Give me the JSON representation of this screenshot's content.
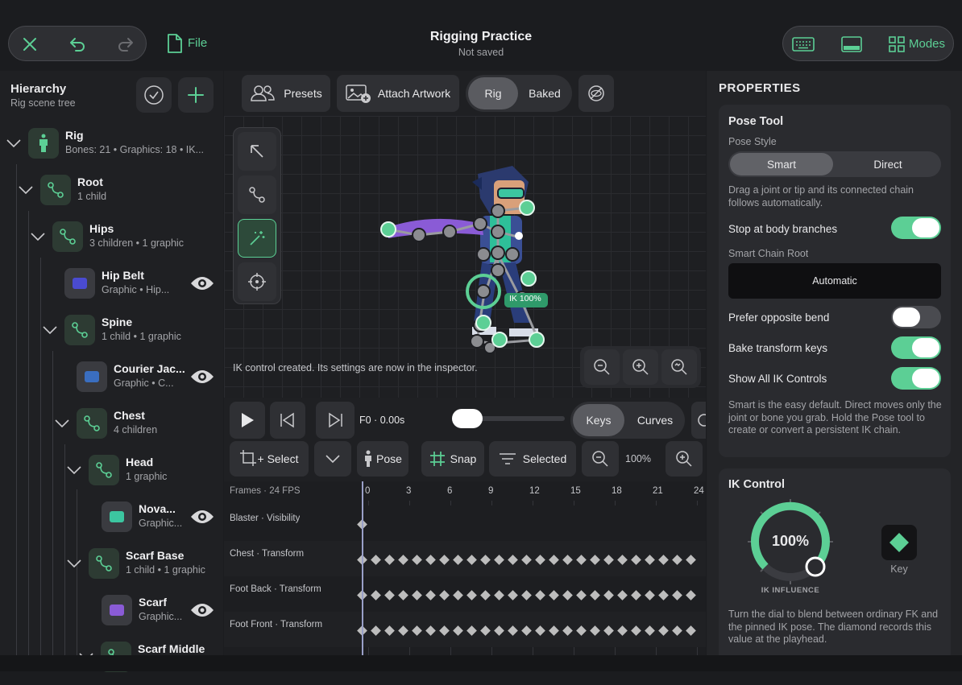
{
  "top": {
    "title": "Rigging Practice",
    "subtitle": "Not saved",
    "file_label": "File",
    "modes_label": "Modes"
  },
  "hierarchy": {
    "title": "Hierarchy",
    "subtitle": "Rig scene tree",
    "items": [
      {
        "name": "Rig",
        "sub": "Bones: 21  •  Graphics: 18  •  IK..."
      },
      {
        "name": "Root",
        "sub": "1 child"
      },
      {
        "name": "Hips",
        "sub": "3 children  •  1 graphic"
      },
      {
        "name": "Hip Belt",
        "sub": "Graphic  •  Hip..."
      },
      {
        "name": "Spine",
        "sub": "1 child  •  1 graphic"
      },
      {
        "name": "Courier Jac...",
        "sub": "Graphic  •  C..."
      },
      {
        "name": "Chest",
        "sub": "4 children"
      },
      {
        "name": "Head",
        "sub": "1 graphic"
      },
      {
        "name": "Nova...",
        "sub": "Graphic..."
      },
      {
        "name": "Scarf Base",
        "sub": "1 child  •  1 graphic"
      },
      {
        "name": "Scarf",
        "sub": "Graphic..."
      },
      {
        "name": "Scarf Middle",
        "sub": ""
      }
    ]
  },
  "toolbar": {
    "presets": "Presets",
    "attach_artwork": "Attach Artwork",
    "rig": "Rig",
    "baked": "Baked"
  },
  "canvas": {
    "status": "IK control created. Its settings are now in the inspector.",
    "ik_badge": "IK 100%"
  },
  "transport": {
    "frame": "F0 · 0.00s",
    "keys": "Keys",
    "curves": "Curves",
    "select": "+ Select",
    "pose": "Pose",
    "snap": "Snap",
    "selected": "Selected",
    "zoom": "100%"
  },
  "timeline": {
    "header": "Frames · 24 FPS",
    "ticks": [
      "0",
      "3",
      "6",
      "9",
      "12",
      "15",
      "18",
      "21",
      "24"
    ],
    "tracks": [
      "Blaster · Visibility",
      "Chest · Transform",
      "Foot Back · Transform",
      "Foot Front · Transform"
    ]
  },
  "properties": {
    "title": "PROPERTIES",
    "pose_tool": {
      "title": "Pose Tool",
      "style_label": "Pose Style",
      "smart": "Smart",
      "direct": "Direct",
      "desc": "Drag a joint or tip and its connected chain follows automatically.",
      "stop_label": "Stop at body branches",
      "stop_on": true,
      "chain_root_label": "Smart Chain Root",
      "chain_root_value": "Automatic",
      "prefer_label": "Prefer opposite bend",
      "prefer_on": false,
      "bake_label": "Bake transform keys",
      "bake_on": true,
      "show_label": "Show All IK Controls",
      "show_on": true,
      "help": "Smart is the easy default. Direct moves only the joint or bone you grab. Hold the Pose tool to create or convert a persistent IK chain."
    },
    "ik_control": {
      "title": "IK Control",
      "value": "100%",
      "influence_label": "IK INFLUENCE",
      "key_label": "Key",
      "help": "Turn the dial to blend between ordinary FK and the pinned IK pose. The diamond records this value at the playhead."
    }
  },
  "colors": {
    "accent": "#5ccf95",
    "bg": "#1b1c1f",
    "panel": "#232427"
  }
}
